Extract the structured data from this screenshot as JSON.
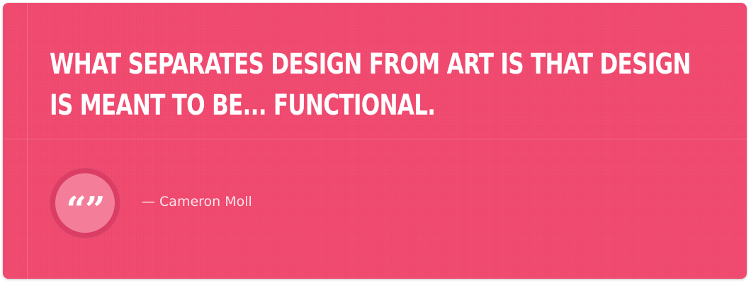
{
  "quote": {
    "line1": "WHAT SEPARATES DESIGN FROM ART IS THAT DESIGN",
    "line2": "IS MEANT TO BE... FUNCTIONAL.",
    "author": "— Cameron Moll",
    "quote_icon_glyph": "“”"
  },
  "colors": {
    "background": "#f0486e",
    "text": "#ffffff",
    "badge": "#f47e9a"
  },
  "icons": {
    "quote": "quotation-marks-icon"
  }
}
